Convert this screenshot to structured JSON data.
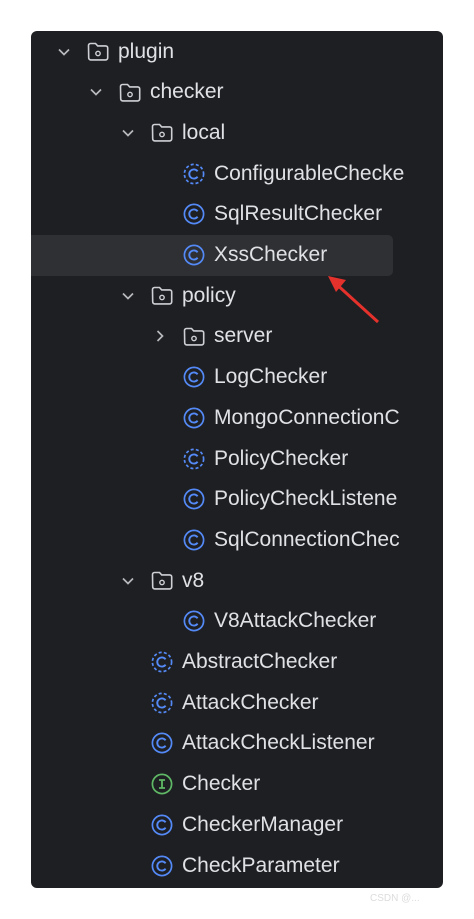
{
  "tree": {
    "rows": [
      {
        "label": "plugin",
        "type": "folder",
        "expanded": true,
        "depth": 0
      },
      {
        "label": "checker",
        "type": "folder",
        "expanded": true,
        "depth": 1
      },
      {
        "label": "local",
        "type": "folder",
        "expanded": true,
        "depth": 2
      },
      {
        "label": "ConfigurableChecke",
        "type": "abstract-class",
        "depth": 3
      },
      {
        "label": "SqlResultChecker",
        "type": "class",
        "depth": 3
      },
      {
        "label": "XssChecker",
        "type": "class",
        "depth": 3,
        "selected": true
      },
      {
        "label": "policy",
        "type": "folder",
        "expanded": true,
        "depth": 2
      },
      {
        "label": "server",
        "type": "folder",
        "expanded": false,
        "depth": 3
      },
      {
        "label": "LogChecker",
        "type": "class",
        "depth": 3
      },
      {
        "label": "MongoConnectionC",
        "type": "class",
        "depth": 3
      },
      {
        "label": "PolicyChecker",
        "type": "abstract-class",
        "depth": 3
      },
      {
        "label": "PolicyCheckListene",
        "type": "class",
        "depth": 3
      },
      {
        "label": "SqlConnectionChec",
        "type": "class",
        "depth": 3
      },
      {
        "label": "v8",
        "type": "folder",
        "expanded": true,
        "depth": 2
      },
      {
        "label": "V8AttackChecker",
        "type": "class",
        "depth": 3
      },
      {
        "label": "AbstractChecker",
        "type": "abstract-class",
        "depth": 2
      },
      {
        "label": "AttackChecker",
        "type": "abstract-class",
        "depth": 2
      },
      {
        "label": "AttackCheckListener",
        "type": "class",
        "depth": 2
      },
      {
        "label": "Checker",
        "type": "interface",
        "depth": 2
      },
      {
        "label": "CheckerManager",
        "type": "class",
        "depth": 2
      },
      {
        "label": "CheckParameter",
        "type": "class",
        "depth": 2
      }
    ]
  },
  "colors": {
    "panel": "#1e1f22",
    "text": "#dfe1e5",
    "class_icon": "#548af7",
    "interface_icon": "#5fb865",
    "folder_icon": "#ced0d6",
    "selection": "#2e3034",
    "annotation_arrow": "#e5312b"
  },
  "watermark": "CSDN @..."
}
